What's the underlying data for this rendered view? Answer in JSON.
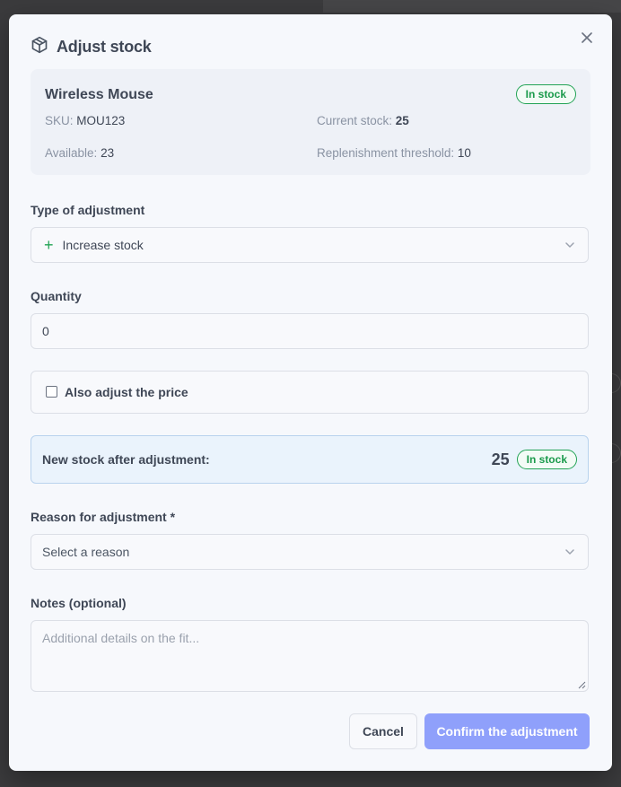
{
  "modal": {
    "title": "Adjust stock",
    "icon": "package-icon"
  },
  "product": {
    "name": "Wireless Mouse",
    "status": "In stock",
    "sku_label": "SKU:",
    "sku": "MOU123",
    "current_stock_label": "Current stock:",
    "current_stock": "25",
    "available_label": "Available:",
    "available": "23",
    "threshold_label": "Replenishment threshold:",
    "threshold": "10"
  },
  "adjustment_type": {
    "label": "Type of adjustment",
    "value": "Increase stock",
    "icon": "plus-icon"
  },
  "quantity": {
    "label": "Quantity",
    "value": "0"
  },
  "price_option": {
    "label": "Also adjust the price",
    "checked": false
  },
  "new_stock": {
    "label": "New stock after adjustment:",
    "value": "25",
    "status": "In stock"
  },
  "reason": {
    "label": "Reason for adjustment *",
    "placeholder": "Select a reason"
  },
  "notes": {
    "label": "Notes (optional)",
    "placeholder": "Additional details on the fit..."
  },
  "buttons": {
    "cancel": "Cancel",
    "confirm": "Confirm the adjustment"
  },
  "colors": {
    "status_green": "#22a355",
    "confirm_button": "#8fa0fb",
    "new_stock_bg": "#eaf3fc"
  }
}
